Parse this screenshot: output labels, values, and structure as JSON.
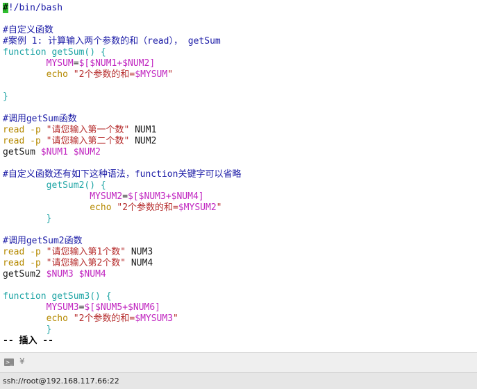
{
  "editor": {
    "lines": [
      {
        "segments": [
          {
            "cls": "cursor",
            "text": "#"
          },
          {
            "cls": "tok-comment",
            "text": "!/bin/bash"
          }
        ]
      },
      {
        "segments": []
      },
      {
        "segments": [
          {
            "cls": "tok-comment",
            "text": "#自定义函数"
          }
        ]
      },
      {
        "segments": [
          {
            "cls": "tok-comment",
            "text": "#案例 1: 计算输入两个参数的和（read）， getSum"
          }
        ]
      },
      {
        "segments": [
          {
            "cls": "tok-keyword",
            "text": "function getSum() {"
          }
        ]
      },
      {
        "segments": [
          {
            "cls": "tok-plain",
            "text": "        "
          },
          {
            "cls": "tok-var",
            "text": "MYSUM"
          },
          {
            "cls": "tok-plain",
            "text": "="
          },
          {
            "cls": "tok-var",
            "text": "$[$NUM1+$NUM2]"
          }
        ]
      },
      {
        "segments": [
          {
            "cls": "tok-plain",
            "text": "        "
          },
          {
            "cls": "tok-cmd",
            "text": "echo"
          },
          {
            "cls": "tok-plain",
            "text": " "
          },
          {
            "cls": "tok-str",
            "text": "\"2个参数的和="
          },
          {
            "cls": "tok-var",
            "text": "$MYSUM"
          },
          {
            "cls": "tok-str",
            "text": "\""
          }
        ]
      },
      {
        "segments": []
      },
      {
        "segments": [
          {
            "cls": "tok-brace",
            "text": "}"
          }
        ]
      },
      {
        "segments": []
      },
      {
        "segments": [
          {
            "cls": "tok-comment",
            "text": "#调用getSum函数"
          }
        ]
      },
      {
        "segments": [
          {
            "cls": "tok-cmd",
            "text": "read"
          },
          {
            "cls": "tok-plain",
            "text": " "
          },
          {
            "cls": "tok-cmd",
            "text": "-p"
          },
          {
            "cls": "tok-plain",
            "text": " "
          },
          {
            "cls": "tok-str",
            "text": "\"请您输入第一个数\""
          },
          {
            "cls": "tok-plain",
            "text": " NUM1"
          }
        ]
      },
      {
        "segments": [
          {
            "cls": "tok-cmd",
            "text": "read"
          },
          {
            "cls": "tok-plain",
            "text": " "
          },
          {
            "cls": "tok-cmd",
            "text": "-p"
          },
          {
            "cls": "tok-plain",
            "text": " "
          },
          {
            "cls": "tok-str",
            "text": "\"请您输入第二个数\""
          },
          {
            "cls": "tok-plain",
            "text": " NUM2"
          }
        ]
      },
      {
        "segments": [
          {
            "cls": "tok-plain",
            "text": "getSum "
          },
          {
            "cls": "tok-var",
            "text": "$NUM1 $NUM2"
          }
        ]
      },
      {
        "segments": []
      },
      {
        "segments": [
          {
            "cls": "tok-comment",
            "text": "#自定义函数还有如下这种语法，function关键字可以省略"
          }
        ]
      },
      {
        "segments": [
          {
            "cls": "tok-plain",
            "text": "        "
          },
          {
            "cls": "tok-keyword",
            "text": "getSum2() {"
          }
        ]
      },
      {
        "segments": [
          {
            "cls": "tok-plain",
            "text": "                "
          },
          {
            "cls": "tok-var",
            "text": "MYSUM2"
          },
          {
            "cls": "tok-plain",
            "text": "="
          },
          {
            "cls": "tok-var",
            "text": "$[$NUM3+$NUM4]"
          }
        ]
      },
      {
        "segments": [
          {
            "cls": "tok-plain",
            "text": "                "
          },
          {
            "cls": "tok-cmd",
            "text": "echo"
          },
          {
            "cls": "tok-plain",
            "text": " "
          },
          {
            "cls": "tok-str",
            "text": "\"2个参数的和="
          },
          {
            "cls": "tok-var",
            "text": "$MYSUM2"
          },
          {
            "cls": "tok-str",
            "text": "\""
          }
        ]
      },
      {
        "segments": [
          {
            "cls": "tok-plain",
            "text": "        "
          },
          {
            "cls": "tok-brace",
            "text": "}"
          }
        ]
      },
      {
        "segments": []
      },
      {
        "segments": [
          {
            "cls": "tok-comment",
            "text": "#调用getSum2函数"
          }
        ]
      },
      {
        "segments": [
          {
            "cls": "tok-cmd",
            "text": "read"
          },
          {
            "cls": "tok-plain",
            "text": " "
          },
          {
            "cls": "tok-cmd",
            "text": "-p"
          },
          {
            "cls": "tok-plain",
            "text": " "
          },
          {
            "cls": "tok-str",
            "text": "\"请您输入第1个数\""
          },
          {
            "cls": "tok-plain",
            "text": " NUM3"
          }
        ]
      },
      {
        "segments": [
          {
            "cls": "tok-cmd",
            "text": "read"
          },
          {
            "cls": "tok-plain",
            "text": " "
          },
          {
            "cls": "tok-cmd",
            "text": "-p"
          },
          {
            "cls": "tok-plain",
            "text": " "
          },
          {
            "cls": "tok-str",
            "text": "\"请您输入第2个数\""
          },
          {
            "cls": "tok-plain",
            "text": " NUM4"
          }
        ]
      },
      {
        "segments": [
          {
            "cls": "tok-plain",
            "text": "getSum2 "
          },
          {
            "cls": "tok-var",
            "text": "$NUM3 $NUM4"
          }
        ]
      },
      {
        "segments": []
      },
      {
        "segments": [
          {
            "cls": "tok-keyword",
            "text": "function getSum3() {"
          }
        ]
      },
      {
        "segments": [
          {
            "cls": "tok-plain",
            "text": "        "
          },
          {
            "cls": "tok-var",
            "text": "MYSUM3"
          },
          {
            "cls": "tok-plain",
            "text": "="
          },
          {
            "cls": "tok-var",
            "text": "$[$NUM5+$NUM6]"
          }
        ]
      },
      {
        "segments": [
          {
            "cls": "tok-plain",
            "text": "        "
          },
          {
            "cls": "tok-cmd",
            "text": "echo"
          },
          {
            "cls": "tok-plain",
            "text": " "
          },
          {
            "cls": "tok-str",
            "text": "\"2个参数的和="
          },
          {
            "cls": "tok-var",
            "text": "$MYSUM3"
          },
          {
            "cls": "tok-str",
            "text": "\""
          }
        ]
      },
      {
        "segments": [
          {
            "cls": "tok-plain",
            "text": "        "
          },
          {
            "cls": "tok-brace",
            "text": "}"
          }
        ]
      },
      {
        "segments": [
          {
            "cls": "tok-mode",
            "text": "-- 插入 --"
          }
        ]
      }
    ]
  },
  "statusbar": {
    "terminal_icon": "terminal-icon",
    "terminal_glyph": ">_",
    "tray_glyph": "¥"
  },
  "connection": {
    "text": "ssh://root@192.168.117.66:22"
  },
  "colors": {
    "comment": "#1a1aa6",
    "keyword": "#1fa5a5",
    "variable": "#c025c0",
    "command": "#b58900",
    "string": "#b52b2b",
    "cursor": "#2fbf2f"
  }
}
